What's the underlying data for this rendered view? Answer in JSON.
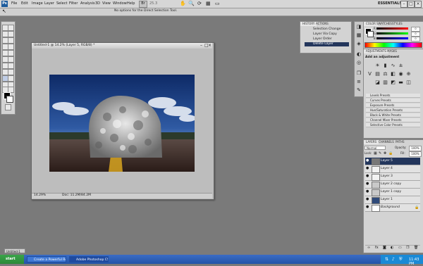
{
  "menubar": {
    "logo": "Ps",
    "items": [
      "File",
      "Edit",
      "Image",
      "Layer",
      "Select",
      "Filter",
      "Analysis",
      "3D",
      "View",
      "Window",
      "Help"
    ],
    "zoom": "25.3",
    "workspace": "ESSENTIALS ▾"
  },
  "options_bar": {
    "text": "No options for the Direct Selection Tool."
  },
  "document": {
    "title": "Untitled-1 @ 14.2% (Layer 5, RGB/8) *",
    "zoom": "14.29%",
    "doc_size": "Doc: 11.2M/84.2M"
  },
  "history": {
    "tabs": [
      "HISTORY",
      "ACTIONS"
    ],
    "items": [
      "Selection Change",
      "Layer Via Copy",
      "Layer Order",
      "Delete Layer"
    ],
    "selected_index": 3
  },
  "color_panel": {
    "tabs": [
      "COLOR",
      "SWATCHES",
      "STYLES"
    ],
    "channels": [
      {
        "label": "R",
        "value": "0",
        "color": "#d23b3b"
      },
      {
        "label": "G",
        "value": "0",
        "color": "#2fb12f"
      },
      {
        "label": "B",
        "value": "0",
        "color": "#3558d4"
      }
    ]
  },
  "adjustments": {
    "tabs": [
      "ADJUSTMENTS",
      "MASKS"
    ],
    "heading": "Add an adjustment",
    "presets": [
      "Levels Presets",
      "Curves Presets",
      "Exposure Presets",
      "Hue/Saturation Presets",
      "Black & White Presets",
      "Channel Mixer Presets",
      "Selective Color Presets"
    ]
  },
  "layers": {
    "tabs": [
      "LAYERS",
      "CHANNELS",
      "PATHS"
    ],
    "blend_mode": "Normal",
    "opacity_label": "Opacity:",
    "opacity_value": "100%",
    "lock_label": "Lock:",
    "fill_label": "Fill:",
    "fill_value": "100%",
    "rows": [
      {
        "name": "Layer 5",
        "selected": true,
        "thumb": "#777"
      },
      {
        "name": "Layer 4",
        "selected": false,
        "thumb": "#f2f2f2"
      },
      {
        "name": "Layer 3",
        "selected": false,
        "thumb": "#f2f2f2"
      },
      {
        "name": "Layer 2 copy",
        "selected": false,
        "thumb": "#c9c9c9"
      },
      {
        "name": "Layer 1 copy",
        "selected": false,
        "thumb": "#c9c9c9"
      },
      {
        "name": "Layer 1",
        "selected": false,
        "thumb": "#2f4a7a"
      },
      {
        "name": "Background",
        "selected": false,
        "thumb": "#ffffff"
      }
    ]
  },
  "taskbar": {
    "start": "start",
    "tasks": [
      "Create a Powerful Rese...",
      "Adobe Photoshop CS4..."
    ],
    "clock": "11:43 PM"
  },
  "minimized_doc": "Untitled-1"
}
